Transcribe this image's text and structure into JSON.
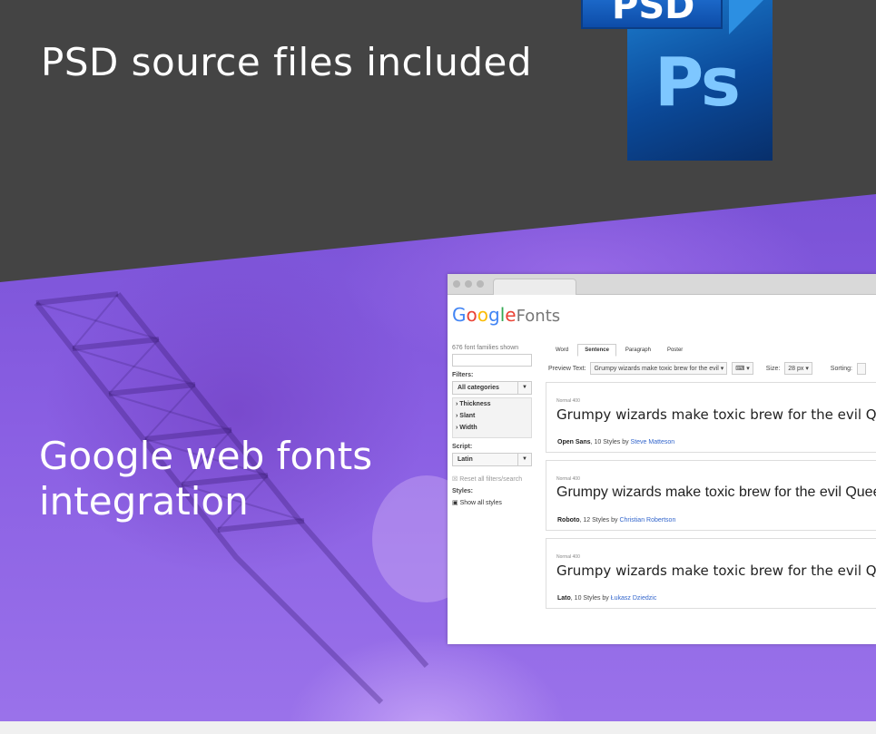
{
  "headings": {
    "psd": "PSD source files included",
    "fonts": "Google web fonts integration"
  },
  "psd_icon": {
    "tag": "PSD",
    "letters": "Ps"
  },
  "browser": {
    "logo": {
      "google": [
        "G",
        "o",
        "o",
        "g",
        "l",
        "e"
      ],
      "suffix": "Fonts"
    },
    "sidebar": {
      "count": "676 font families shown",
      "filters_label": "Filters:",
      "category": "All categories",
      "toggles": [
        "› Thickness",
        "› Slant",
        "› Width"
      ],
      "script_label": "Script:",
      "script_value": "Latin",
      "reset": "Reset all filters/search",
      "styles_label": "Styles:",
      "show_all": "Show all styles"
    },
    "tabs": [
      "Word",
      "Sentence",
      "Paragraph",
      "Poster"
    ],
    "active_tab": "Sentence",
    "controls": {
      "preview_label": "Preview Text:",
      "preview_value": "Grumpy wizards make toxic brew for the evil",
      "size_label": "Size:",
      "size_value": "28 px",
      "sorting_label": "Sorting:"
    },
    "cards": [
      {
        "sub": "Normal 400",
        "sample": "Grumpy wizards make toxic brew for the evil Queen and Jack.",
        "font": "Open Sans",
        "styles": ", 10 Styles by ",
        "author": "Steve Matteson"
      },
      {
        "sub": "Normal 400",
        "sample": "Grumpy wizards make toxic brew for the evil Queen and Jack.",
        "font": "Roboto",
        "styles": ", 12 Styles by ",
        "author": "Christian Robertson"
      },
      {
        "sub": "Normal 400",
        "sample": "Grumpy wizards make toxic brew for the evil Queen and Jack.",
        "font": "Lato",
        "styles": ", 10 Styles by ",
        "author": "Łukasz Dziedzic"
      }
    ]
  },
  "colors": {
    "dark_band": "#444444",
    "purple": "#8a5fe3",
    "google": [
      "#4285f4",
      "#ea4335",
      "#fbbc05",
      "#4285f4",
      "#34a853",
      "#ea4335"
    ]
  }
}
